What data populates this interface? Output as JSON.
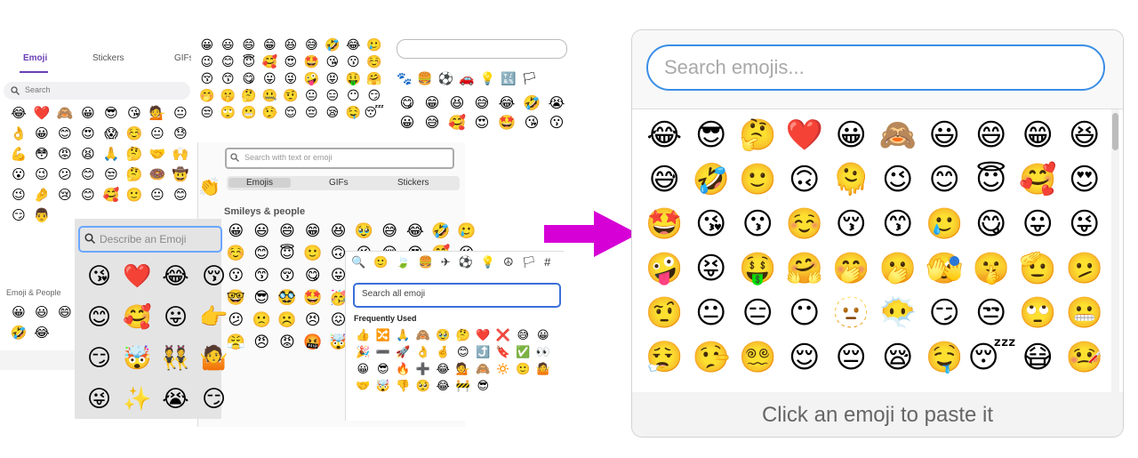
{
  "collage": {
    "panel1": {
      "tabs": [
        "Emoji",
        "Stickers",
        "GIFs"
      ],
      "search_placeholder": "Search",
      "emojis": [
        "😂",
        "❤️",
        "🙈",
        "😀",
        "😎",
        "😘",
        "💁",
        "😐",
        "👌",
        "😀",
        "😊",
        "😍",
        "😱",
        "☺️",
        "😐",
        "😓",
        "💪",
        "😳",
        "😡",
        "😫",
        "🙏",
        "🤔",
        "🤝",
        "🙌",
        "😮",
        "😉",
        "😕",
        "😊",
        "😒",
        "🤔",
        "🍩",
        "🤠",
        "😉",
        "🤌",
        "😢",
        "😊",
        "🥰",
        "🙂",
        "😐",
        "😊",
        "😏",
        "👨"
      ],
      "section_label": "Emoji & People",
      "section_emojis": [
        "😀",
        "😃",
        "😄",
        "😁",
        "😆",
        "😅",
        "🤣",
        "😂",
        "🤣",
        "😂"
      ]
    },
    "panel2": {
      "emojis": [
        "😀",
        "😃",
        "😄",
        "😁",
        "😆",
        "😅",
        "🤣",
        "😂",
        "🥲",
        "😉",
        "😊",
        "😇",
        "🥰",
        "😍",
        "🤩",
        "😘",
        "😗",
        "☺️",
        "😚",
        "😙",
        "😋",
        "😛",
        "😜",
        "🤪",
        "😝",
        "🤑",
        "🤗",
        "🤭",
        "🤫",
        "🤔",
        "🤐",
        "🤨",
        "😐",
        "😑",
        "😶",
        "😏",
        "😒",
        "🙄",
        "😬",
        "🤥",
        "😌",
        "😔",
        "😪",
        "🤤",
        "😴"
      ]
    },
    "panel3": {
      "category_icons": [
        "🐾",
        "🍔",
        "⚽",
        "🚗",
        "💡",
        "🔣",
        "🏳"
      ],
      "emojis": [
        "😋",
        "😁",
        "😆",
        "😅",
        "😂",
        "🤣",
        "😭",
        "😀",
        "😅",
        "🥰",
        "😍",
        "🤩",
        "😘",
        "😗"
      ]
    },
    "panel4": {
      "search_placeholder": "Search with text or emoji",
      "tabs": [
        "Emojis",
        "GIFs",
        "Stickers"
      ],
      "section_title": "Smileys & people",
      "side_emoji": "👏",
      "emojis": [
        "😀",
        "😃",
        "😄",
        "😁",
        "😆",
        "🥹",
        "😅",
        "😂",
        "🤣",
        "🥲",
        "☺️",
        "😊",
        "😇",
        "🙂",
        "🙃",
        "😉",
        "😌",
        "😍",
        "🥰",
        "😘",
        "😗",
        "😙",
        "😚",
        "😋",
        "😛",
        "😝",
        "😜",
        "🤪",
        "🤨",
        "🧐",
        "🤓",
        "😎",
        "🥸",
        "🤩",
        "🥳",
        "😏",
        "😒",
        "😞",
        "😔",
        "😟",
        "😕",
        "🙁",
        "☹️",
        "😣",
        "😖",
        "😫",
        "😩",
        "🥺",
        "😢",
        "😭",
        "😤",
        "😠",
        "😡",
        "🤬",
        "🤯",
        "😳",
        "🥵",
        "🥶",
        "😱",
        "😨"
      ]
    },
    "panel5": {
      "search_placeholder": "Describe an Emoji",
      "emojis": [
        "😘",
        "❤️",
        "😂",
        "😚",
        "😊",
        "🥰",
        "😛",
        "👉",
        "😏",
        "🤯",
        "👯",
        "🤷",
        "😜",
        "✨",
        "😭",
        "😏"
      ]
    },
    "panel6": {
      "tab_icons": [
        "🔍",
        "🙂",
        "🍃",
        "🍔",
        "✈",
        "⚽",
        "💡",
        "☮",
        "🏳",
        "#"
      ],
      "search_placeholder": "Search all emoji",
      "section_title": "Frequently Used",
      "emojis": [
        "👍",
        "🔀",
        "🙏",
        "🙈",
        "🥹",
        "🤔",
        "❤️",
        "❌",
        "😅",
        "😀",
        "🎉",
        "➖",
        "🚀",
        "👌",
        "🤞",
        "😊",
        "⤴️",
        "🔖",
        "✅",
        "👀",
        "😀",
        "😎",
        "🔥",
        "➕",
        "😂",
        "💁",
        "🙈",
        "🔅",
        "🙂",
        "🤷",
        "🤝",
        "🤯",
        "👎",
        "🥺",
        "😂",
        "🚧",
        "😎"
      ]
    }
  },
  "arrow": {
    "color": "#d600d6"
  },
  "picker": {
    "search_placeholder": "Search emojis...",
    "emojis": [
      "😂",
      "😎",
      "🤔",
      "❤️",
      "😀",
      "🙈",
      "😃",
      "😄",
      "😁",
      "😆",
      "😅",
      "🤣",
      "🙂",
      "🙃",
      "🫠",
      "😉",
      "😊",
      "😇",
      "🥰",
      "😍",
      "🤩",
      "😘",
      "😗",
      "☺️",
      "😚",
      "😙",
      "🥲",
      "😋",
      "😛",
      "😜",
      "🤪",
      "😝",
      "🤑",
      "🤗",
      "🤭",
      "🫢",
      "🫣",
      "🤫",
      "🫡",
      "🫤",
      "🤨",
      "😐",
      "😑",
      "😶",
      "🫥",
      "😶‍🌫️",
      "😏",
      "😒",
      "🙄",
      "😬",
      "😮‍💨",
      "🤥",
      "😵‍💫",
      "😌",
      "😔",
      "😪",
      "🤤",
      "😴",
      "😷",
      "🤒"
    ],
    "footer_text": "Click an emoji to paste it",
    "accent_color": "#3a8ee6",
    "badge_color": "#2b77d8"
  }
}
